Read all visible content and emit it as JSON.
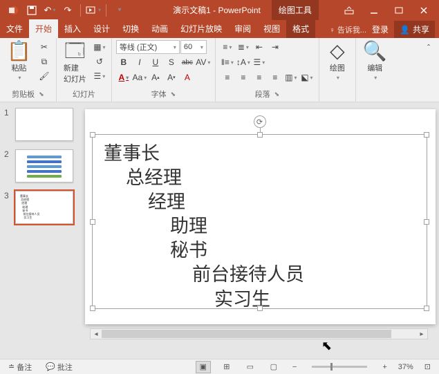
{
  "titlebar": {
    "doc_title": "演示文稿1 - PowerPoint",
    "context_tools": "绘图工具"
  },
  "tabs": {
    "file": "文件",
    "home": "开始",
    "insert": "插入",
    "design": "设计",
    "transitions": "切换",
    "animations": "动画",
    "slideshow": "幻灯片放映",
    "review": "审阅",
    "view": "视图",
    "format": "格式",
    "tell_me": "告诉我...",
    "login": "登录",
    "share": "共享"
  },
  "ribbon": {
    "clipboard": {
      "label": "剪贴板",
      "paste": "粘贴"
    },
    "slides": {
      "label": "幻灯片",
      "new_slide": "新建\n幻灯片"
    },
    "font": {
      "label": "字体",
      "name": "等线 (正文)",
      "size": "60",
      "bold": "B",
      "italic": "I",
      "underline": "U",
      "shadow": "S",
      "strike": "abc",
      "spacing": "AV",
      "clear": "A",
      "case": "Aa"
    },
    "paragraph": {
      "label": "段落"
    },
    "drawing": {
      "label": "绘图"
    },
    "editing": {
      "label": "编辑"
    }
  },
  "thumbs": [
    {
      "num": "1"
    },
    {
      "num": "2"
    },
    {
      "num": "3"
    }
  ],
  "slide_text": [
    "董事长",
    "总经理",
    "经理",
    "助理",
    "秘书",
    "前台接待人员",
    "实习生"
  ],
  "status": {
    "notes": "备注",
    "comments": "批注",
    "zoom": "37%"
  }
}
